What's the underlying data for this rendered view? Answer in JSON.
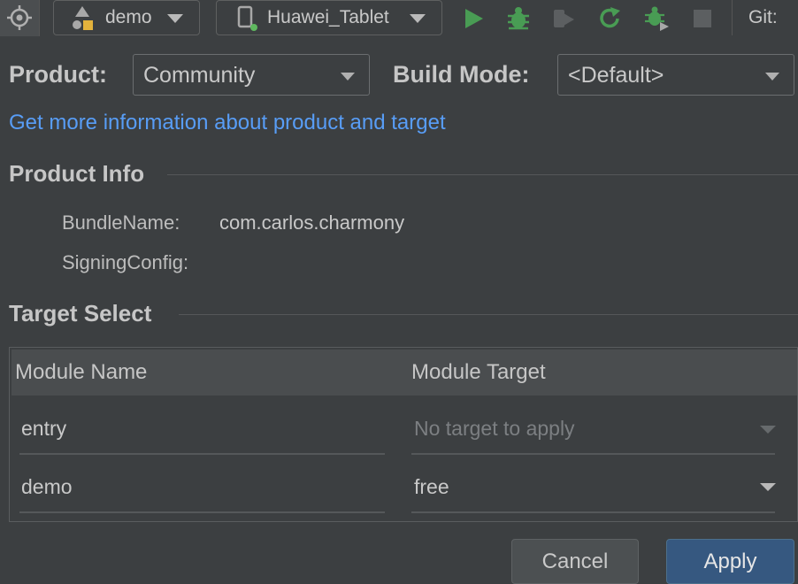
{
  "toolbar": {
    "module_selector": "demo",
    "device_selector": "Huawei_Tablet",
    "git_label": "Git:",
    "colors": {
      "run": "#499c54",
      "accent": "#499c54"
    }
  },
  "product": {
    "label": "Product:",
    "value": "Community"
  },
  "build_mode": {
    "label": "Build Mode:",
    "value": "<Default>"
  },
  "info_link": "Get more information about product and target",
  "product_info": {
    "heading": "Product Info",
    "bundle_name_label": "BundleName:",
    "bundle_name_value": "com.carlos.charmony",
    "signing_config_label": "SigningConfig:",
    "signing_config_value": ""
  },
  "target_select": {
    "heading": "Target Select",
    "columns": [
      "Module Name",
      "Module Target"
    ],
    "rows": [
      {
        "module": "entry",
        "target": "No target to apply",
        "disabled": true
      },
      {
        "module": "demo",
        "target": "free",
        "disabled": false
      }
    ]
  },
  "buttons": {
    "cancel": "Cancel",
    "apply": "Apply"
  }
}
